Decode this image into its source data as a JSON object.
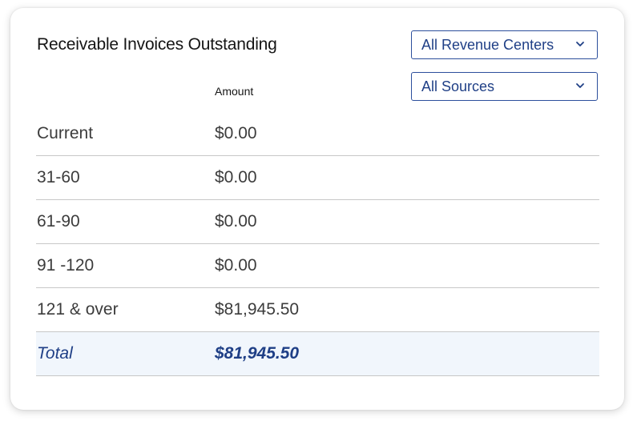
{
  "widget": {
    "title": "Receivable Invoices Outstanding",
    "filters": {
      "revenue_center": {
        "selected": "All Revenue Centers",
        "icon": "chevron-down-icon"
      },
      "source": {
        "selected": "All Sources",
        "icon": "chevron-down-icon"
      }
    },
    "column_header": "Amount",
    "rows": [
      {
        "label": "Current",
        "amount": "$0.00"
      },
      {
        "label": "31-60",
        "amount": "$0.00"
      },
      {
        "label": "61-90",
        "amount": "$0.00"
      },
      {
        "label": "91 -120",
        "amount": "$0.00"
      },
      {
        "label": "121 & over",
        "amount": "$81,945.50"
      }
    ],
    "total": {
      "label": "Total",
      "amount": "$81,945.50"
    }
  },
  "colors": {
    "accent": "#1f3f86",
    "border": "#2c4f9c",
    "total_row_bg": "#f1f6fc",
    "divider": "#c7c7c7"
  }
}
